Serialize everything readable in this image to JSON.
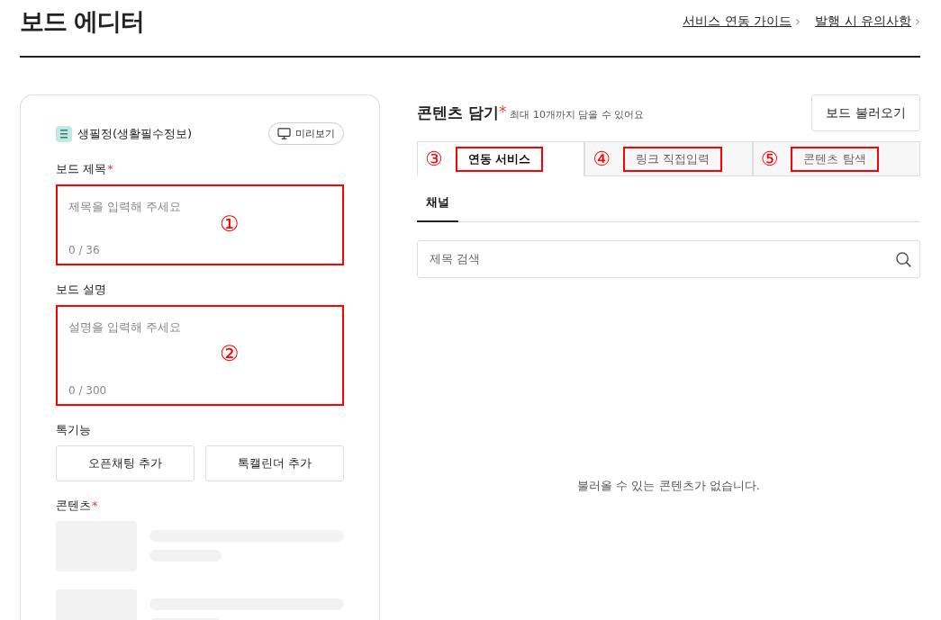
{
  "header": {
    "title": "보드 에디터",
    "links": [
      {
        "label": "서비스 연동 가이드",
        "chevron": "›"
      },
      {
        "label": "발행 시 유의사항",
        "chevron": "›"
      }
    ]
  },
  "editor": {
    "channel_name": "생필정(생활필수정보)",
    "preview_button": "미리보기",
    "fields": [
      {
        "label": "보드 제목",
        "required_mark": "*",
        "placeholder": "제목을 입력해 주세요",
        "counter": "0 / 36",
        "kind": "short",
        "highlighted": true,
        "marker": "①"
      },
      {
        "label": "보드 설명",
        "placeholder": "설명을 입력해 주세요",
        "counter": "0 / 300",
        "kind": "long",
        "highlighted": true,
        "marker": "②"
      }
    ],
    "talk_features": {
      "label": "톡기능",
      "buttons": [
        "오픈채팅 추가",
        "톡캘린더 추가"
      ]
    },
    "contents": {
      "label": "콘텐츠",
      "required_mark": "*"
    }
  },
  "content_picker": {
    "title": "콘텐츠 담기",
    "required_mark": "*",
    "hint": "최대 10개까지 담을 수 있어요",
    "load_button": "보드 불러오기",
    "tabs": [
      {
        "label": "연동 서비스",
        "selected": true,
        "highlighted": true,
        "marker": "③"
      },
      {
        "label": "링크 직접입력",
        "selected": false,
        "highlighted": true,
        "marker": "④"
      },
      {
        "label": "콘텐츠 탐색",
        "selected": false,
        "highlighted": true,
        "marker": "⑤"
      }
    ],
    "subtabs": [
      {
        "label": "채널",
        "selected": true
      }
    ],
    "search": {
      "placeholder": "제목 검색"
    },
    "empty_message": "불러올 수 있는 콘텐츠가 없습니다."
  }
}
